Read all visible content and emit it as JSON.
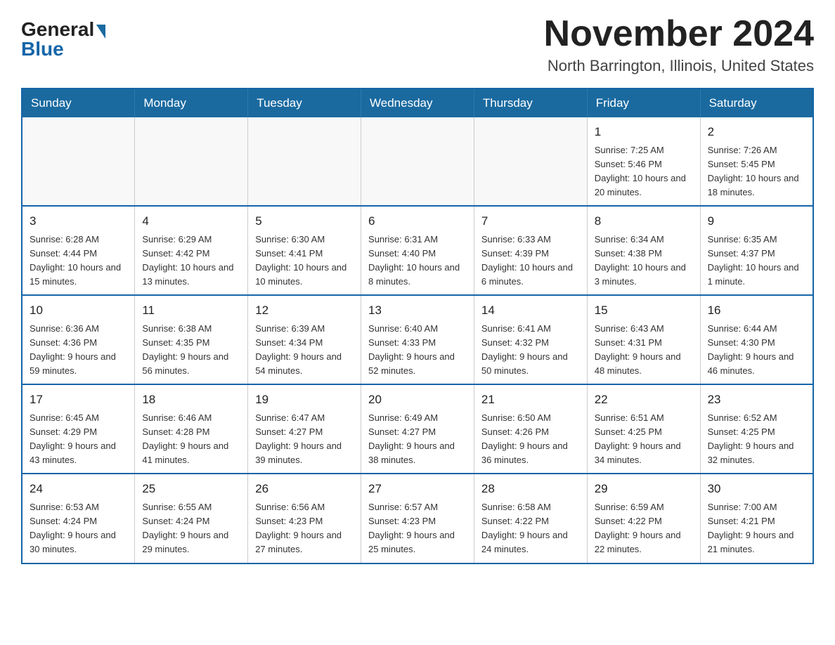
{
  "logo": {
    "general": "General",
    "blue": "Blue"
  },
  "header": {
    "month_year": "November 2024",
    "location": "North Barrington, Illinois, United States"
  },
  "weekdays": [
    "Sunday",
    "Monday",
    "Tuesday",
    "Wednesday",
    "Thursday",
    "Friday",
    "Saturday"
  ],
  "rows": [
    [
      {
        "day": "",
        "info": ""
      },
      {
        "day": "",
        "info": ""
      },
      {
        "day": "",
        "info": ""
      },
      {
        "day": "",
        "info": ""
      },
      {
        "day": "",
        "info": ""
      },
      {
        "day": "1",
        "info": "Sunrise: 7:25 AM\nSunset: 5:46 PM\nDaylight: 10 hours and 20 minutes."
      },
      {
        "day": "2",
        "info": "Sunrise: 7:26 AM\nSunset: 5:45 PM\nDaylight: 10 hours and 18 minutes."
      }
    ],
    [
      {
        "day": "3",
        "info": "Sunrise: 6:28 AM\nSunset: 4:44 PM\nDaylight: 10 hours and 15 minutes."
      },
      {
        "day": "4",
        "info": "Sunrise: 6:29 AM\nSunset: 4:42 PM\nDaylight: 10 hours and 13 minutes."
      },
      {
        "day": "5",
        "info": "Sunrise: 6:30 AM\nSunset: 4:41 PM\nDaylight: 10 hours and 10 minutes."
      },
      {
        "day": "6",
        "info": "Sunrise: 6:31 AM\nSunset: 4:40 PM\nDaylight: 10 hours and 8 minutes."
      },
      {
        "day": "7",
        "info": "Sunrise: 6:33 AM\nSunset: 4:39 PM\nDaylight: 10 hours and 6 minutes."
      },
      {
        "day": "8",
        "info": "Sunrise: 6:34 AM\nSunset: 4:38 PM\nDaylight: 10 hours and 3 minutes."
      },
      {
        "day": "9",
        "info": "Sunrise: 6:35 AM\nSunset: 4:37 PM\nDaylight: 10 hours and 1 minute."
      }
    ],
    [
      {
        "day": "10",
        "info": "Sunrise: 6:36 AM\nSunset: 4:36 PM\nDaylight: 9 hours and 59 minutes."
      },
      {
        "day": "11",
        "info": "Sunrise: 6:38 AM\nSunset: 4:35 PM\nDaylight: 9 hours and 56 minutes."
      },
      {
        "day": "12",
        "info": "Sunrise: 6:39 AM\nSunset: 4:34 PM\nDaylight: 9 hours and 54 minutes."
      },
      {
        "day": "13",
        "info": "Sunrise: 6:40 AM\nSunset: 4:33 PM\nDaylight: 9 hours and 52 minutes."
      },
      {
        "day": "14",
        "info": "Sunrise: 6:41 AM\nSunset: 4:32 PM\nDaylight: 9 hours and 50 minutes."
      },
      {
        "day": "15",
        "info": "Sunrise: 6:43 AM\nSunset: 4:31 PM\nDaylight: 9 hours and 48 minutes."
      },
      {
        "day": "16",
        "info": "Sunrise: 6:44 AM\nSunset: 4:30 PM\nDaylight: 9 hours and 46 minutes."
      }
    ],
    [
      {
        "day": "17",
        "info": "Sunrise: 6:45 AM\nSunset: 4:29 PM\nDaylight: 9 hours and 43 minutes."
      },
      {
        "day": "18",
        "info": "Sunrise: 6:46 AM\nSunset: 4:28 PM\nDaylight: 9 hours and 41 minutes."
      },
      {
        "day": "19",
        "info": "Sunrise: 6:47 AM\nSunset: 4:27 PM\nDaylight: 9 hours and 39 minutes."
      },
      {
        "day": "20",
        "info": "Sunrise: 6:49 AM\nSunset: 4:27 PM\nDaylight: 9 hours and 38 minutes."
      },
      {
        "day": "21",
        "info": "Sunrise: 6:50 AM\nSunset: 4:26 PM\nDaylight: 9 hours and 36 minutes."
      },
      {
        "day": "22",
        "info": "Sunrise: 6:51 AM\nSunset: 4:25 PM\nDaylight: 9 hours and 34 minutes."
      },
      {
        "day": "23",
        "info": "Sunrise: 6:52 AM\nSunset: 4:25 PM\nDaylight: 9 hours and 32 minutes."
      }
    ],
    [
      {
        "day": "24",
        "info": "Sunrise: 6:53 AM\nSunset: 4:24 PM\nDaylight: 9 hours and 30 minutes."
      },
      {
        "day": "25",
        "info": "Sunrise: 6:55 AM\nSunset: 4:24 PM\nDaylight: 9 hours and 29 minutes."
      },
      {
        "day": "26",
        "info": "Sunrise: 6:56 AM\nSunset: 4:23 PM\nDaylight: 9 hours and 27 minutes."
      },
      {
        "day": "27",
        "info": "Sunrise: 6:57 AM\nSunset: 4:23 PM\nDaylight: 9 hours and 25 minutes."
      },
      {
        "day": "28",
        "info": "Sunrise: 6:58 AM\nSunset: 4:22 PM\nDaylight: 9 hours and 24 minutes."
      },
      {
        "day": "29",
        "info": "Sunrise: 6:59 AM\nSunset: 4:22 PM\nDaylight: 9 hours and 22 minutes."
      },
      {
        "day": "30",
        "info": "Sunrise: 7:00 AM\nSunset: 4:21 PM\nDaylight: 9 hours and 21 minutes."
      }
    ]
  ]
}
